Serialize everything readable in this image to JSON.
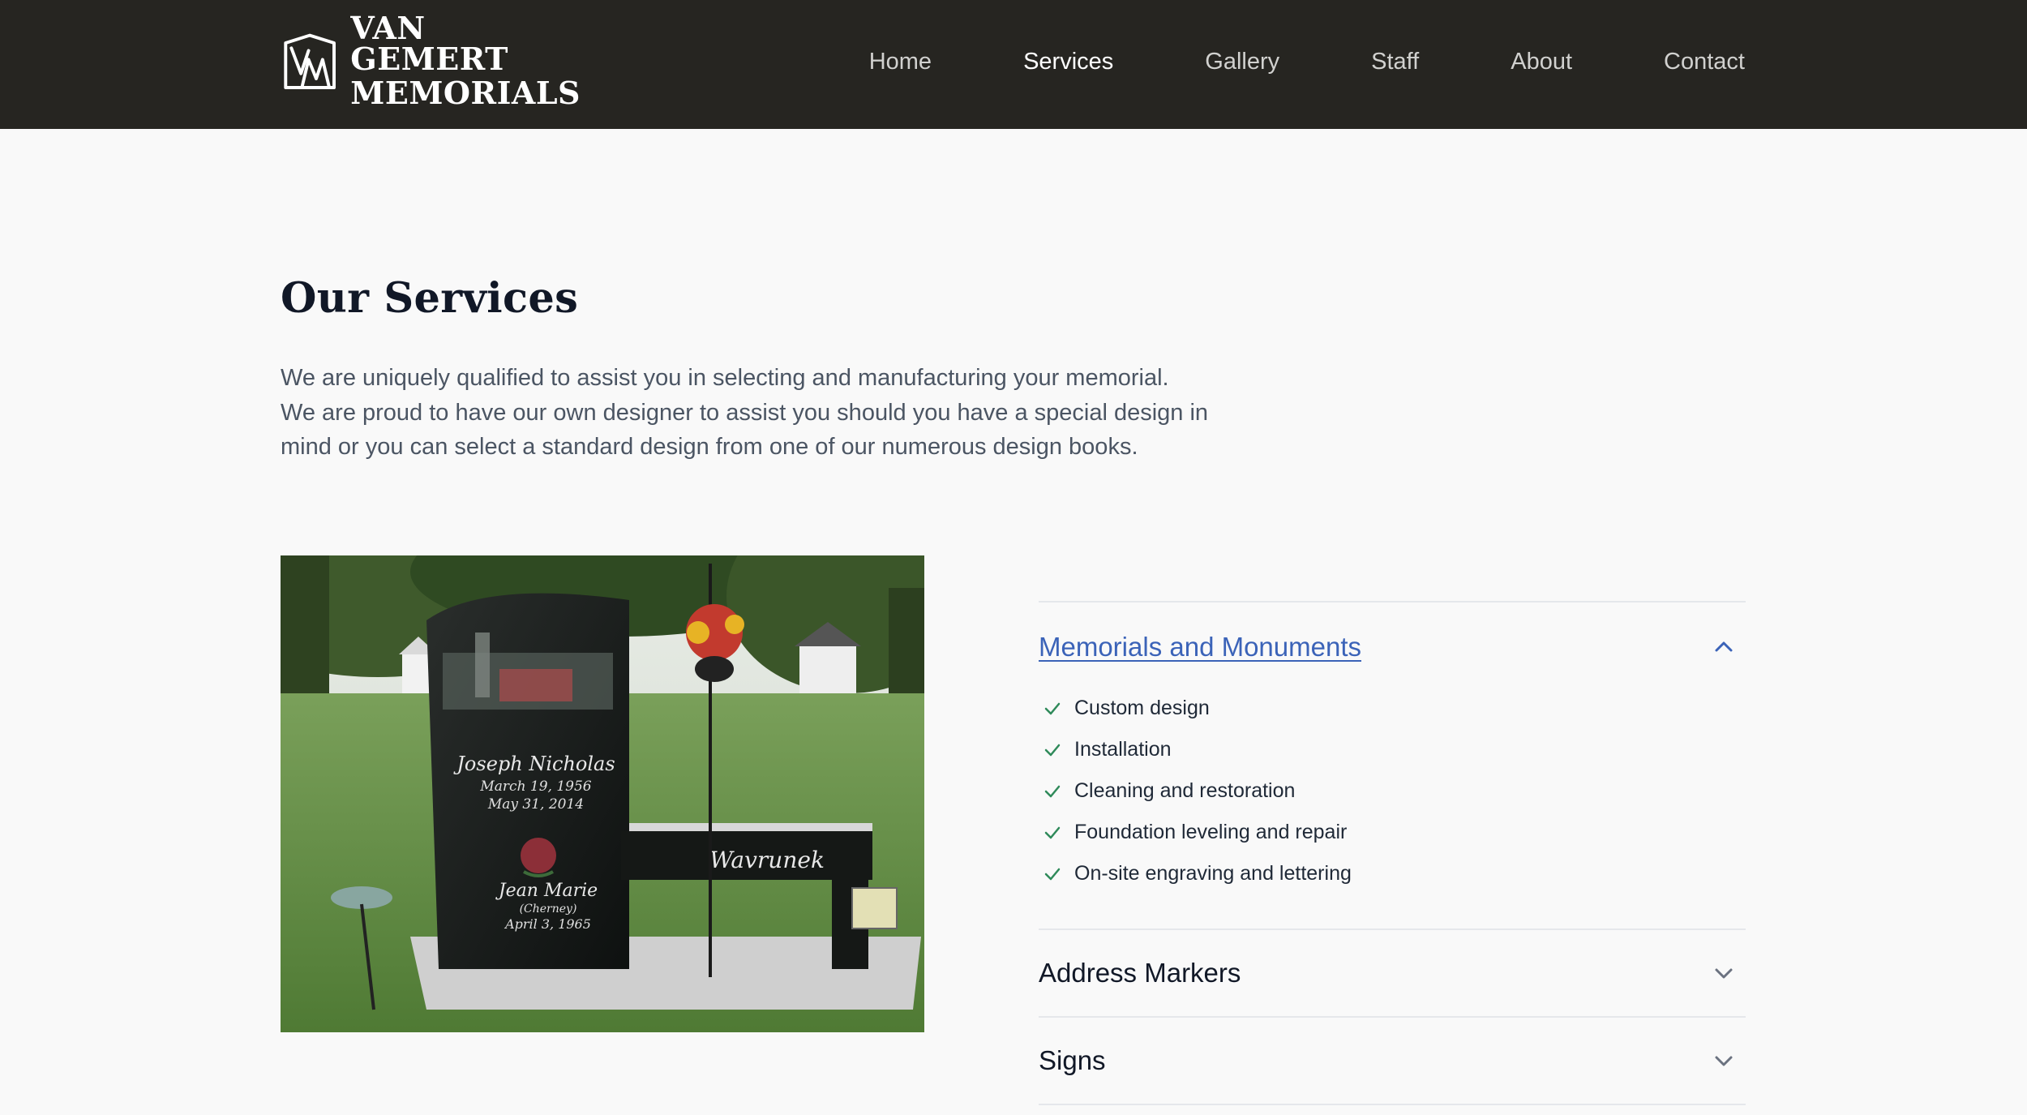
{
  "brand": {
    "name_line1": "VAN GEMERT",
    "name_line2": "MEMORIALS",
    "logo_icon": "vm-monogram-icon"
  },
  "nav": {
    "items": [
      {
        "label": "Home",
        "active": false
      },
      {
        "label": "Services",
        "active": true
      },
      {
        "label": "Gallery",
        "active": false
      },
      {
        "label": "Staff",
        "active": false
      },
      {
        "label": "About",
        "active": false
      },
      {
        "label": "Contact",
        "active": false
      }
    ]
  },
  "page": {
    "title": "Our Services",
    "intro_line1": "We are uniquely qualified to assist you in selecting and manufacturing your memorial.",
    "intro_line2": "We are proud to have our own designer to assist you should you have a special design in",
    "intro_line3": "mind or you can select a standard design from one of our numerous design books."
  },
  "photo": {
    "engraving_name1": "Joseph Nicholas",
    "engraving_date1a": "March 19, 1956",
    "engraving_date1b": "May 31, 2014",
    "engraving_name2": "Jean Marie",
    "engraving_maiden": "(Cherney)",
    "engraving_date2": "April 3, 1965",
    "bench_name": "Wavrunek"
  },
  "accordion": {
    "sections": [
      {
        "title": "Memorials and Monuments",
        "expanded": true,
        "icon": "chevron-up-icon",
        "items": [
          "Custom design",
          "Installation",
          "Cleaning and restoration",
          "Foundation leveling and repair",
          "On-site engraving and lettering"
        ]
      },
      {
        "title": "Address Markers",
        "expanded": false,
        "icon": "chevron-down-icon"
      },
      {
        "title": "Signs",
        "expanded": false,
        "icon": "chevron-down-icon"
      }
    ]
  },
  "colors": {
    "header_bg": "#262521",
    "page_bg": "#f9f9f9",
    "link_blue": "#3b63b8",
    "check_green": "#2f8a5a",
    "divider": "#e5e7eb"
  }
}
